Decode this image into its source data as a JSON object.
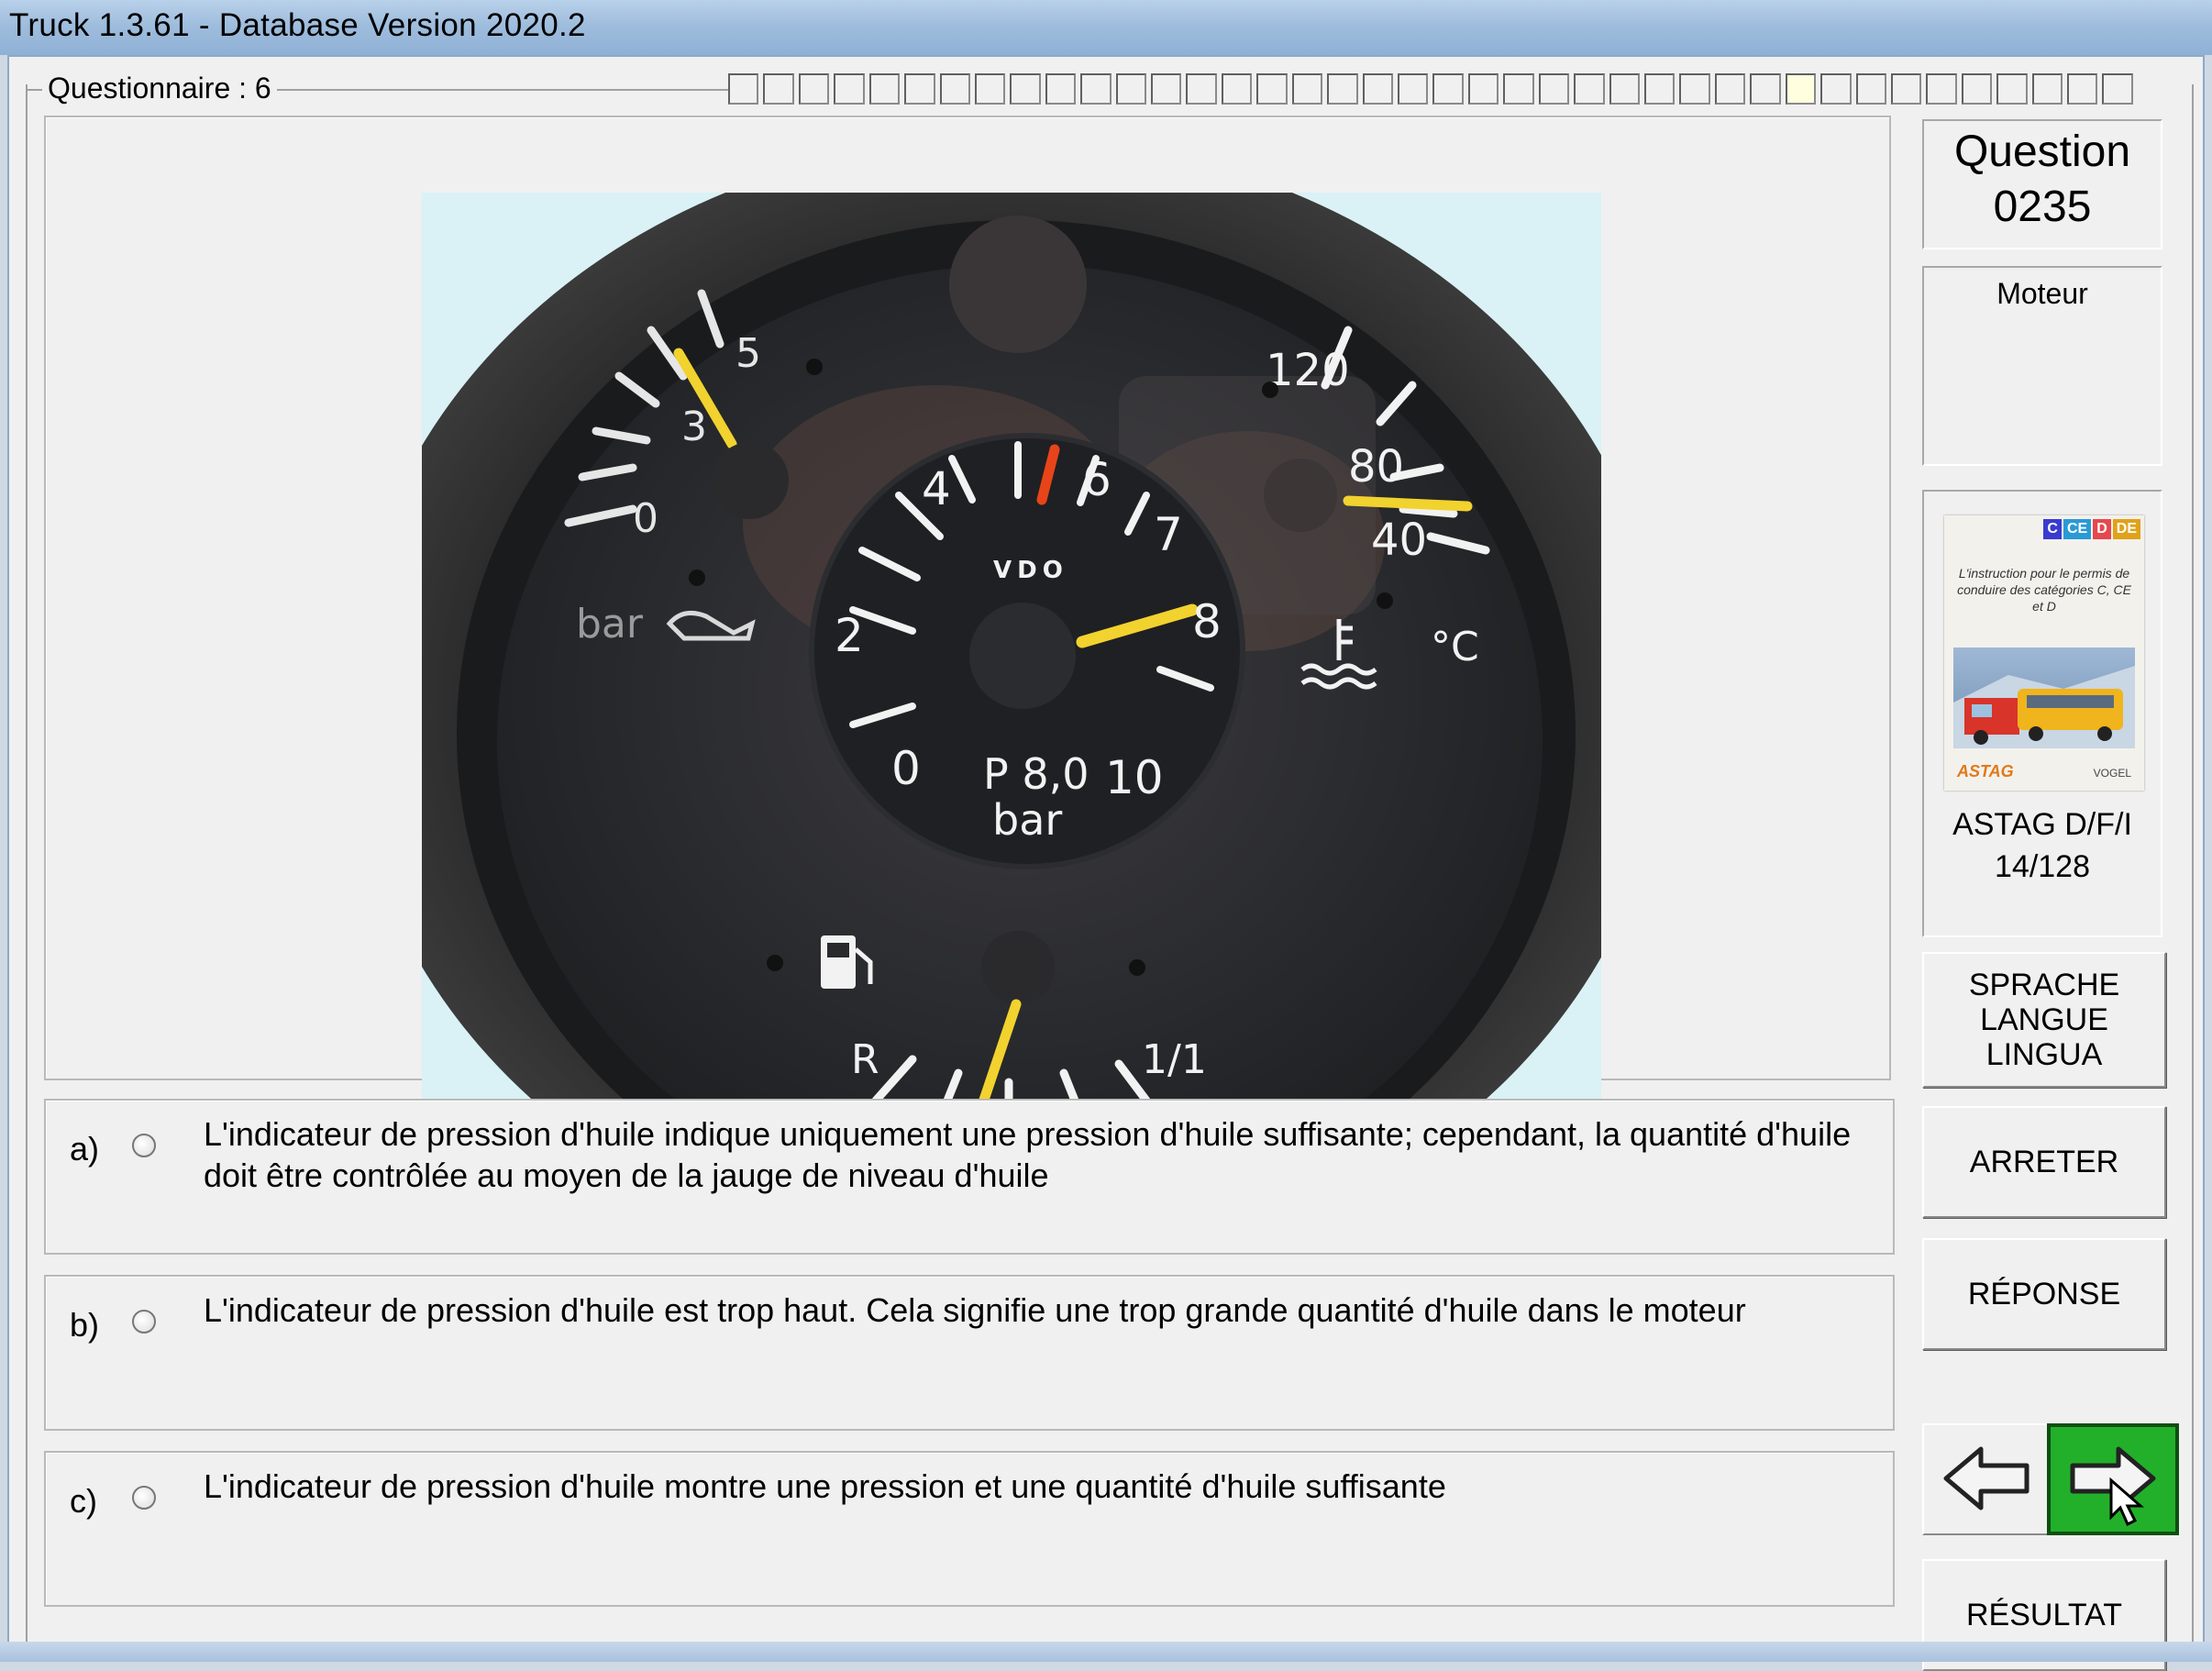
{
  "window": {
    "title": "Truck 1.3.61 - Database Version 2020.2"
  },
  "questionnaire": {
    "label": "Questionnaire : 6",
    "progress_total": 40,
    "progress_current": 31
  },
  "question": {
    "label": "Question",
    "number": "0235",
    "category": "Moteur"
  },
  "gauge_photo": {
    "oil_pressure": {
      "unit": "bar",
      "ticks": [
        "0",
        "3",
        "5"
      ]
    },
    "tachometer": {
      "brand": "VDO",
      "ticks": [
        "0",
        "2",
        "4",
        "6",
        "7",
        "8",
        "10"
      ],
      "pressure_label": "P 8,0",
      "pressure_unit": "bar"
    },
    "temperature": {
      "unit": "°C",
      "ticks": [
        "40",
        "80",
        "120"
      ]
    },
    "fuel": {
      "ticks": [
        "R",
        "1/1"
      ]
    }
  },
  "book": {
    "tags": [
      "C",
      "CE",
      "D",
      "DE"
    ],
    "tag_colors": [
      "#3a3ad0",
      "#2a9ad6",
      "#e5484d",
      "#e0a21a"
    ],
    "text": "L'instruction pour le permis de conduire des catégories C, CE et D",
    "logo_left": "ASTAG",
    "logo_right": "VOGEL",
    "source_line1": "ASTAG D/F/I",
    "source_line2": "14/128"
  },
  "answers": [
    {
      "letter": "a)",
      "text": "L'indicateur de pression d'huile indique uniquement une pression d'huile suffisante; cependant, la quantité d'huile doit être contrôlée au moyen de la jauge de niveau d'huile"
    },
    {
      "letter": "b)",
      "text": "L'indicateur de pression d'huile est trop haut. Cela signifie une trop grande quantité d'huile dans le moteur"
    },
    {
      "letter": "c)",
      "text": "L'indicateur de pression d'huile montre une pression et une quantité d'huile suffisante"
    }
  ],
  "buttons": {
    "language_line1": "SPRACHE",
    "language_line2": "LANGUE",
    "language_line3": "LINGUA",
    "stop": "ARRETER",
    "answer": "RÉPONSE",
    "result": "RÉSULTAT"
  },
  "colors": {
    "next_button": "#22b02a",
    "needle": "#f2d22e",
    "redline": "#e8441a"
  }
}
